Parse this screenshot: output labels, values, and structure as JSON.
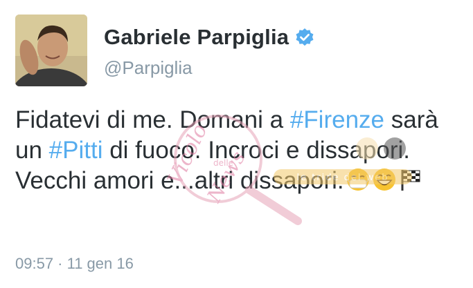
{
  "user": {
    "display_name": "Gabriele Parpiglia",
    "handle": "@Parpiglia",
    "verified_icon": "verified-badge-icon",
    "accent_color": "#55acee"
  },
  "tweet": {
    "segments": [
      {
        "text": "Fidatevi di me. Domani a ",
        "type": "text"
      },
      {
        "text": "#Firenze",
        "type": "hashtag"
      },
      {
        "text": " sarà un ",
        "type": "text"
      },
      {
        "text": "#Pitti",
        "type": "hashtag"
      },
      {
        "text": " di fuoco. Incroci e dissapori. Vecchi amori e...altri dissapori.",
        "type": "text"
      }
    ],
    "emojis": [
      "mask-face-emoji",
      "grinning-face-emoji",
      "checkered-flag-emoji"
    ],
    "timestamp": "09:57 · 11 gen 16"
  },
  "watermark": {
    "lines": [
      "Vicolo",
      "delle",
      "News"
    ],
    "banner": "le tride del web"
  }
}
